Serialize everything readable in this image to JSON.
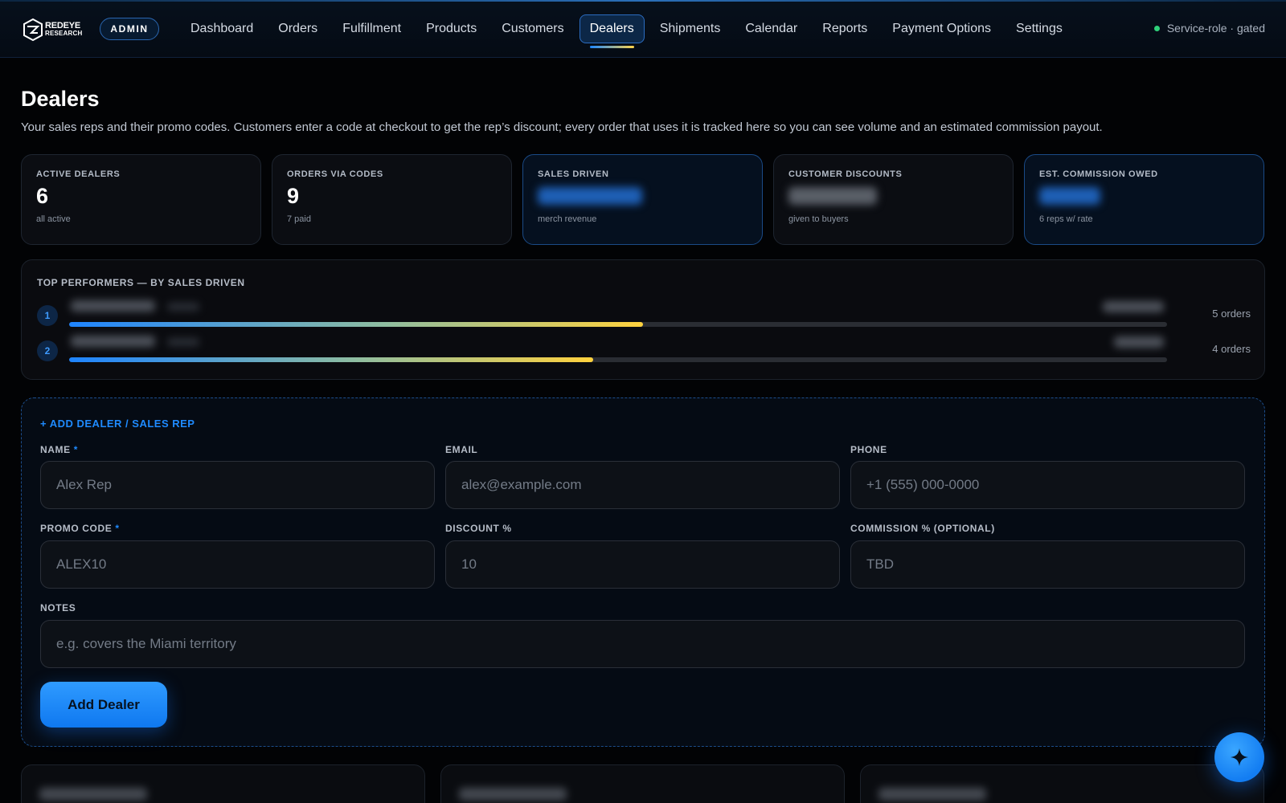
{
  "header": {
    "logo": {
      "line1": "REDEYE",
      "line2": "RESEARCH"
    },
    "role_badge": "ADMIN",
    "nav": [
      {
        "label": "Dashboard",
        "active": false
      },
      {
        "label": "Orders",
        "active": false
      },
      {
        "label": "Fulfillment",
        "active": false
      },
      {
        "label": "Products",
        "active": false
      },
      {
        "label": "Customers",
        "active": false
      },
      {
        "label": "Dealers",
        "active": true
      },
      {
        "label": "Shipments",
        "active": false
      },
      {
        "label": "Calendar",
        "active": false
      },
      {
        "label": "Reports",
        "active": false
      },
      {
        "label": "Payment Options",
        "active": false
      },
      {
        "label": "Settings",
        "active": false
      }
    ],
    "status": "Service-role · gated"
  },
  "page": {
    "title": "Dealers",
    "description": "Your sales reps and their promo codes. Customers enter a code at checkout to get the rep’s discount; every order that uses it is tracked here so you can see volume and an estimated commission payout."
  },
  "stats": [
    {
      "label": "ACTIVE DEALERS",
      "value": "6",
      "sub": "all active"
    },
    {
      "label": "ORDERS VIA CODES",
      "value": "9",
      "sub": "7 paid"
    },
    {
      "label": "SALES DRIVEN",
      "value": "",
      "sub": "merch revenue"
    },
    {
      "label": "CUSTOMER DISCOUNTS",
      "value": "",
      "sub": "given to buyers"
    },
    {
      "label": "EST. COMMISSION OWED",
      "value": "",
      "sub": "6 reps w/ rate"
    }
  ],
  "top_performers": {
    "title": "TOP PERFORMERS — BY SALES DRIVEN",
    "rows": [
      {
        "rank": "1",
        "orders": "5 orders",
        "share": 0.523
      },
      {
        "rank": "2",
        "orders": "4 orders",
        "share": 0.477
      }
    ]
  },
  "add_dealer": {
    "title": "+ ADD DEALER / SALES REP",
    "fields": {
      "name": {
        "label": "NAME",
        "required_mark": "*",
        "placeholder": "Alex Rep"
      },
      "email": {
        "label": "EMAIL",
        "placeholder": "alex@example.com"
      },
      "phone": {
        "label": "PHONE",
        "placeholder": "+1 (555) 000-0000"
      },
      "promo": {
        "label": "PROMO CODE",
        "required_mark": "*",
        "placeholder": "ALEX10"
      },
      "discount": {
        "label": "DISCOUNT %",
        "placeholder": "10"
      },
      "commission": {
        "label": "COMMISSION % (OPTIONAL)",
        "placeholder": "TBD"
      },
      "notes": {
        "label": "NOTES",
        "placeholder": "e.g. covers the Miami territory"
      }
    },
    "submit_label": "Add Dealer"
  },
  "colors": {
    "accent": "#1f8bff",
    "status_ok": "#2fd17a",
    "bar_start": "#1e84ff",
    "bar_end": "#ffd23e"
  },
  "icons": {
    "logo": "shield-logo-icon",
    "status": "status-dot-icon",
    "fab": "sparkle-icon"
  }
}
